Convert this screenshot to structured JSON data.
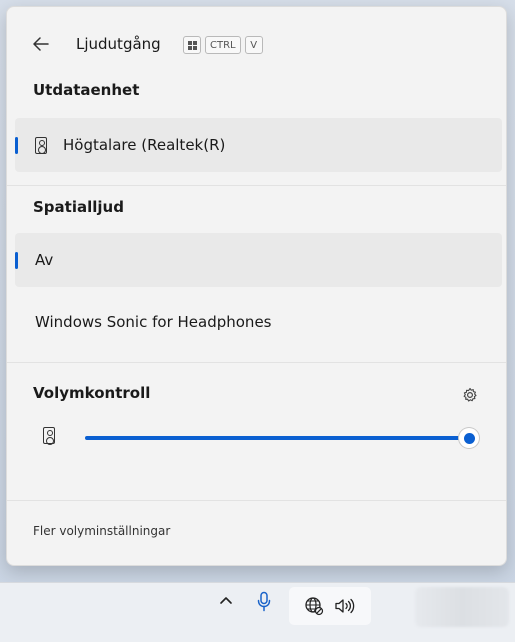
{
  "header": {
    "back_icon": "arrow-left-icon",
    "title": "Ljudutgång",
    "shortcut_keys": [
      "CTRL",
      "V"
    ]
  },
  "output_section": {
    "title": "Utdataenhet",
    "devices": [
      {
        "label": "Högtalare (Realtek(R)",
        "icon": "speaker-icon",
        "selected": true
      }
    ]
  },
  "spatial_section": {
    "title": "Spatialljud",
    "options": [
      {
        "label": "Av",
        "selected": true
      },
      {
        "label": "Windows Sonic for Headphones",
        "selected": false
      }
    ]
  },
  "volume_section": {
    "title": "Volymkontroll",
    "settings_icon": "gear-icon",
    "device_icon": "speaker-icon",
    "level_percent": 100
  },
  "footer": {
    "more_settings": "Fler volyminställningar"
  },
  "taskbar": {
    "icons": [
      "chevron-up-icon",
      "microphone-icon",
      "network-icon",
      "volume-icon"
    ]
  },
  "colors": {
    "accent": "#0a5fd1",
    "flyout_bg": "#f3f3f3",
    "selected_bg": "#e9e9e9"
  }
}
